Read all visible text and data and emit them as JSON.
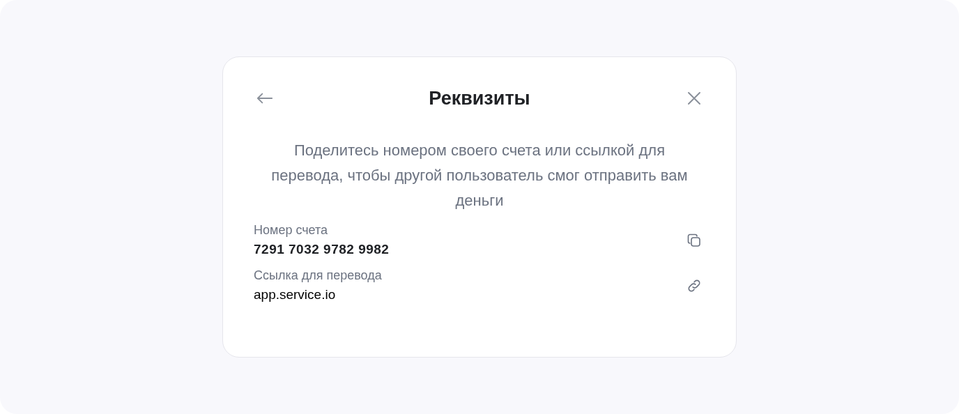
{
  "dialog": {
    "title": "Реквизиты",
    "description": "Поделитесь номером своего счета или ссылкой для перевода, чтобы другой пользователь смог отправить вам деньги",
    "fields": [
      {
        "kind": "account",
        "label": "Номер счета",
        "value": "7291 7032 9782 9982"
      },
      {
        "kind": "link",
        "label": "Ссылка для перевода",
        "value": "app.service.io"
      }
    ]
  }
}
